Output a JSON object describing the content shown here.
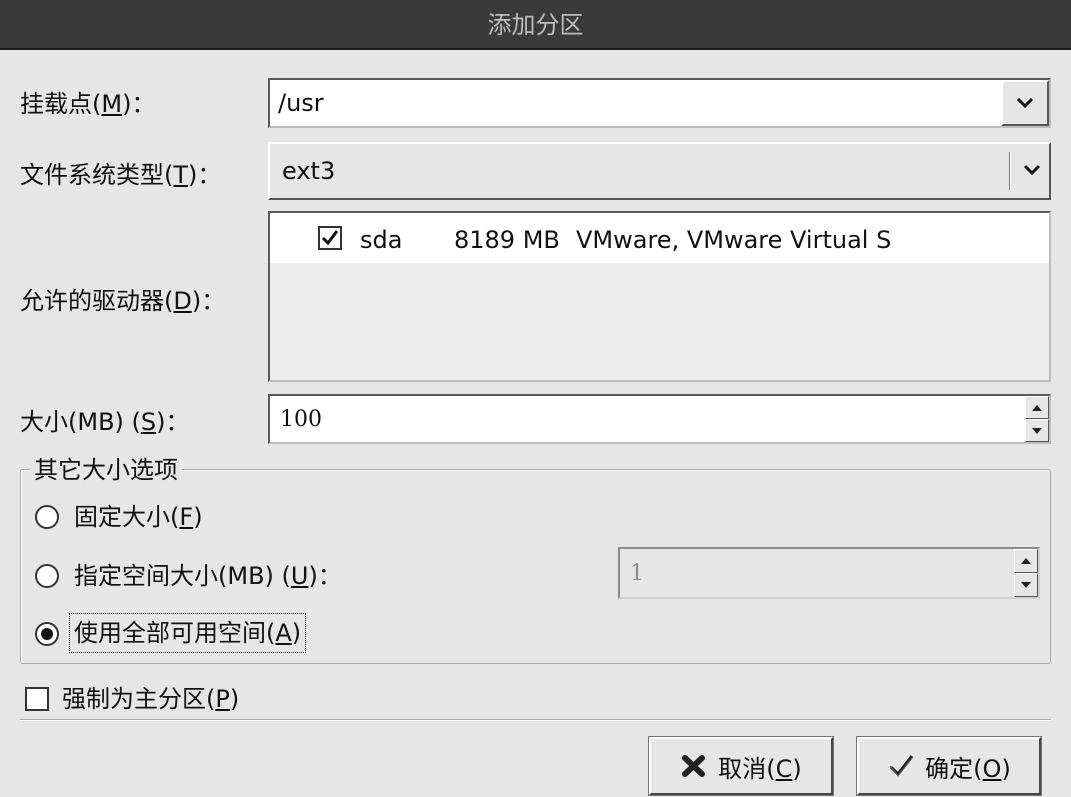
{
  "window": {
    "title": "添加分区"
  },
  "mount_point": {
    "label_pre": "挂载点(",
    "mnemonic": "M",
    "label_post": ")：",
    "value": "/usr"
  },
  "filesystem": {
    "label_pre": "文件系统类型(",
    "mnemonic": "T",
    "label_post": ")：",
    "value": "ext3"
  },
  "drives": {
    "label_pre": "允许的驱动器(",
    "mnemonic": "D",
    "label_post": ")：",
    "rows": [
      {
        "checked": true,
        "name": "sda",
        "size": "8189 MB",
        "model": "VMware, VMware Virtual S"
      }
    ]
  },
  "size": {
    "label_pre": "大小(MB) (",
    "mnemonic": "S",
    "label_post": ")：",
    "value": "100"
  },
  "size_options": {
    "legend": "其它大小选项",
    "fixed": {
      "label_pre": "固定大小(",
      "mnemonic": "F",
      "label_post": ")",
      "selected": false
    },
    "fill_to": {
      "label_pre": "指定空间大小(MB) (",
      "mnemonic": "U",
      "label_post": ")：",
      "selected": false,
      "value": "1"
    },
    "fill_all": {
      "label_pre": "使用全部可用空间(",
      "mnemonic": "A",
      "label_post": ")",
      "selected": true
    }
  },
  "primary": {
    "label_pre": "强制为主分区(",
    "mnemonic": "P",
    "label_post": ")",
    "checked": false
  },
  "buttons": {
    "cancel": {
      "label_pre": "取消(",
      "mnemonic": "C",
      "label_post": ")"
    },
    "ok": {
      "label_pre": "确定(",
      "mnemonic": "O",
      "label_post": ")"
    }
  },
  "colors": {
    "titlebar": "#3a3a3a",
    "dialog": "#e6e6e6",
    "field": "#ffffff"
  },
  "icons": {
    "combo": "chevron-down-icon",
    "cancel": "cancel-x-icon",
    "ok": "checkmark-icon"
  }
}
